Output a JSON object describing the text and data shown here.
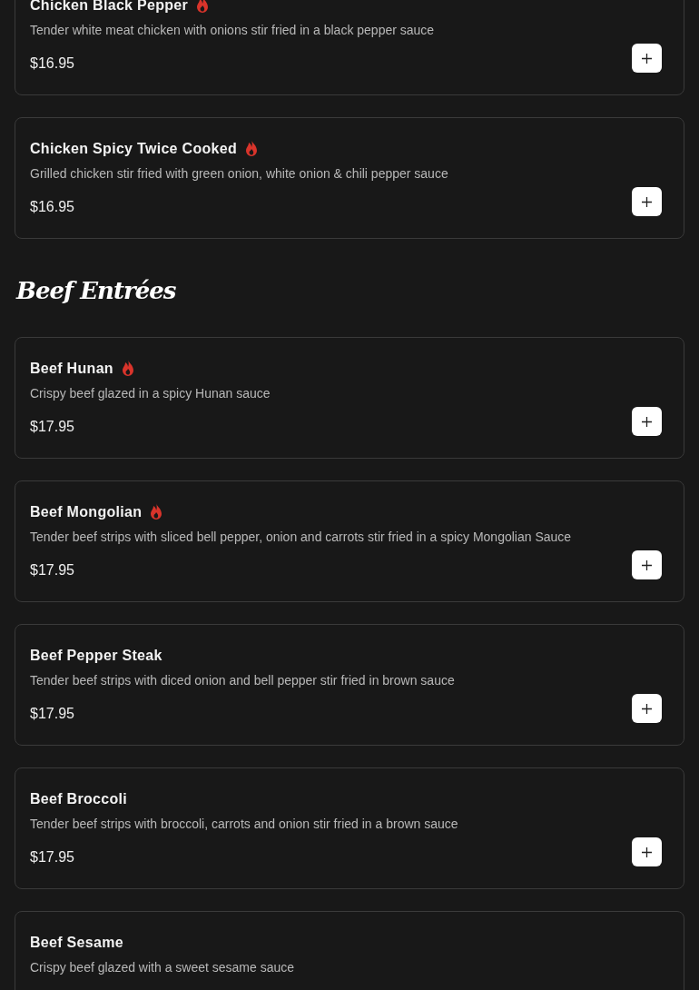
{
  "sections": [
    {
      "items": [
        {
          "name": "Chicken Black Pepper",
          "spicy": true,
          "description": "Tender white meat chicken with onions stir fried in a black pepper sauce",
          "price": "$16.95"
        },
        {
          "name": "Chicken Spicy Twice Cooked",
          "spicy": true,
          "description": "Grilled chicken stir fried with green onion, white onion & chili pepper sauce",
          "price": "$16.95"
        }
      ]
    },
    {
      "heading": "Beef Entrées",
      "items": [
        {
          "name": "Beef Hunan",
          "spicy": true,
          "description": "Crispy beef glazed in a spicy Hunan sauce",
          "price": "$17.95"
        },
        {
          "name": "Beef Mongolian",
          "spicy": true,
          "description": "Tender beef strips with sliced bell pepper, onion and carrots stir fried in a spicy Mongolian Sauce",
          "price": "$17.95"
        },
        {
          "name": "Beef Pepper Steak",
          "spicy": false,
          "description": "Tender beef strips with diced onion and bell pepper stir fried in brown sauce",
          "price": "$17.95"
        },
        {
          "name": "Beef Broccoli",
          "spicy": false,
          "description": "Tender beef strips with broccoli, carrots and onion stir fried in a brown sauce",
          "price": "$17.95"
        },
        {
          "name": "Beef Sesame",
          "spicy": false,
          "description": "Crispy beef glazed with a sweet sesame sauce"
        }
      ]
    }
  ]
}
